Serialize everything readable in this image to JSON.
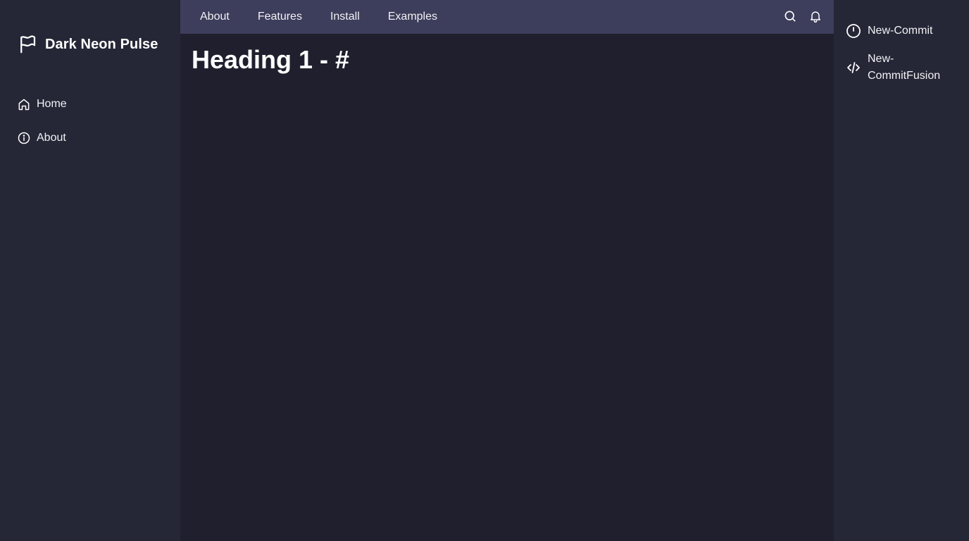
{
  "app": {
    "brand_title": "Dark Neon Pulse"
  },
  "sidebar": {
    "items": [
      {
        "label": "Home",
        "icon": "home-icon"
      },
      {
        "label": "About",
        "icon": "info-icon"
      }
    ]
  },
  "topbar": {
    "links": [
      "About",
      "Features",
      "Install",
      "Examples"
    ],
    "actions": [
      "search-icon",
      "bell-icon"
    ]
  },
  "main": {
    "title": "Heading 1 - #"
  },
  "toc": {
    "items": [
      {
        "label": "New-Commit",
        "icon": "clock-icon"
      },
      {
        "label": "New-CommitFusion",
        "icon": "code-icon"
      }
    ]
  },
  "colors": {
    "sidebar_bg": "#252636",
    "main_bg": "#1f1f2e",
    "topbar_bg": "#3d3d5c",
    "text": "#f2f2f5"
  }
}
